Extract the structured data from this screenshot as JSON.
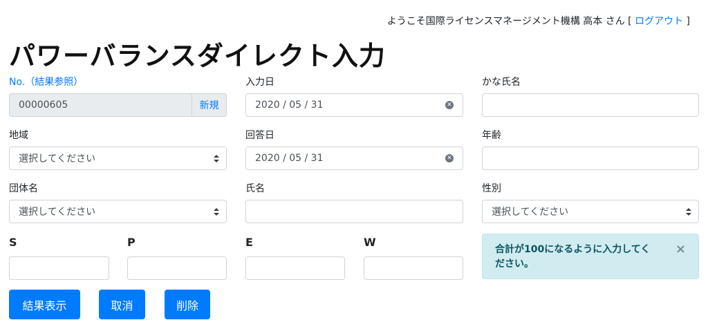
{
  "header": {
    "welcome_text": "ようこそ国際ライセンスマネージメント機構  高本 さん [ ",
    "logout_label": "ログアウト",
    "bracket_close": " ]"
  },
  "page_title": "パワーバランスダイレクト入力",
  "form": {
    "number": {
      "label": "No.（結果参照）",
      "value": "00000605",
      "new_label": "新規"
    },
    "input_date": {
      "label": "入力日",
      "value": "2020 / 05 / 31"
    },
    "kana_name": {
      "label": "かな氏名",
      "value": ""
    },
    "region": {
      "label": "地域",
      "selected": "選択してください"
    },
    "answer_date": {
      "label": "回答日",
      "value": "2020 / 05 / 31"
    },
    "age": {
      "label": "年齢",
      "value": ""
    },
    "group": {
      "label": "団体名",
      "selected": "選択してください"
    },
    "name": {
      "label": "氏名",
      "value": ""
    },
    "gender": {
      "label": "性別",
      "selected": "選択してください"
    },
    "s": {
      "label": "S",
      "value": ""
    },
    "p": {
      "label": "P",
      "value": ""
    },
    "e": {
      "label": "E",
      "value": ""
    },
    "w": {
      "label": "W",
      "value": ""
    }
  },
  "alert": {
    "message": "合計が100になるように入力してください。",
    "close_glyph": "×"
  },
  "buttons": {
    "show_result": "結果表示",
    "cancel": "取消",
    "delete": "削除"
  },
  "icons": {
    "clear": "clear-circle-icon",
    "select": "select-arrows-icon",
    "close": "close-icon"
  },
  "colors": {
    "primary": "#007bff",
    "alert_bg": "#d1ecf1",
    "alert_text": "#0c5460"
  }
}
